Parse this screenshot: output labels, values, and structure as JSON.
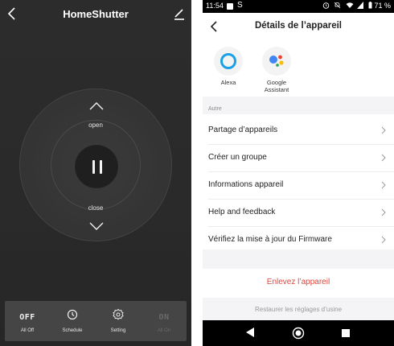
{
  "left": {
    "header": {
      "title": "HomeShutter"
    },
    "dial": {
      "open_label": "open",
      "close_label": "close"
    },
    "bottom_bar": {
      "items": [
        {
          "icon_text": "OFF",
          "label": "All Off",
          "enabled": true
        },
        {
          "icon": "clock-icon",
          "label": "Schedule",
          "enabled": true
        },
        {
          "icon": "gear-icon",
          "label": "Setting",
          "enabled": true
        },
        {
          "icon_text": "ON",
          "label": "All On",
          "enabled": false
        }
      ]
    },
    "colors": {
      "background": "#2a2a2a",
      "bar": "#454545"
    }
  },
  "right": {
    "status_bar": {
      "time": "11:54",
      "s_icon": "S",
      "battery": "71 %"
    },
    "header": {
      "title": "Détails de l’appareil"
    },
    "assistants": [
      {
        "name": "Alexa",
        "icon": "alexa-icon",
        "color": "#1ca0e6"
      },
      {
        "name": "Google Assistant",
        "name_line1": "Google",
        "name_line2": "Assistant",
        "icon": "google-assistant-icon"
      }
    ],
    "section_label": "Autre",
    "menu": [
      {
        "label": "Partage d’appareils"
      },
      {
        "label": "Créer un groupe"
      },
      {
        "label": "Informations appareil"
      },
      {
        "label": "Help and feedback"
      },
      {
        "label": "Vérifiez la mise à jour du Firmware"
      }
    ],
    "remove_label": "Enlevez l’appareil",
    "restore_label": "Restaurer les réglages d’usine",
    "colors": {
      "danger": "#e0443b",
      "section_bg": "#f4f4f6"
    }
  }
}
